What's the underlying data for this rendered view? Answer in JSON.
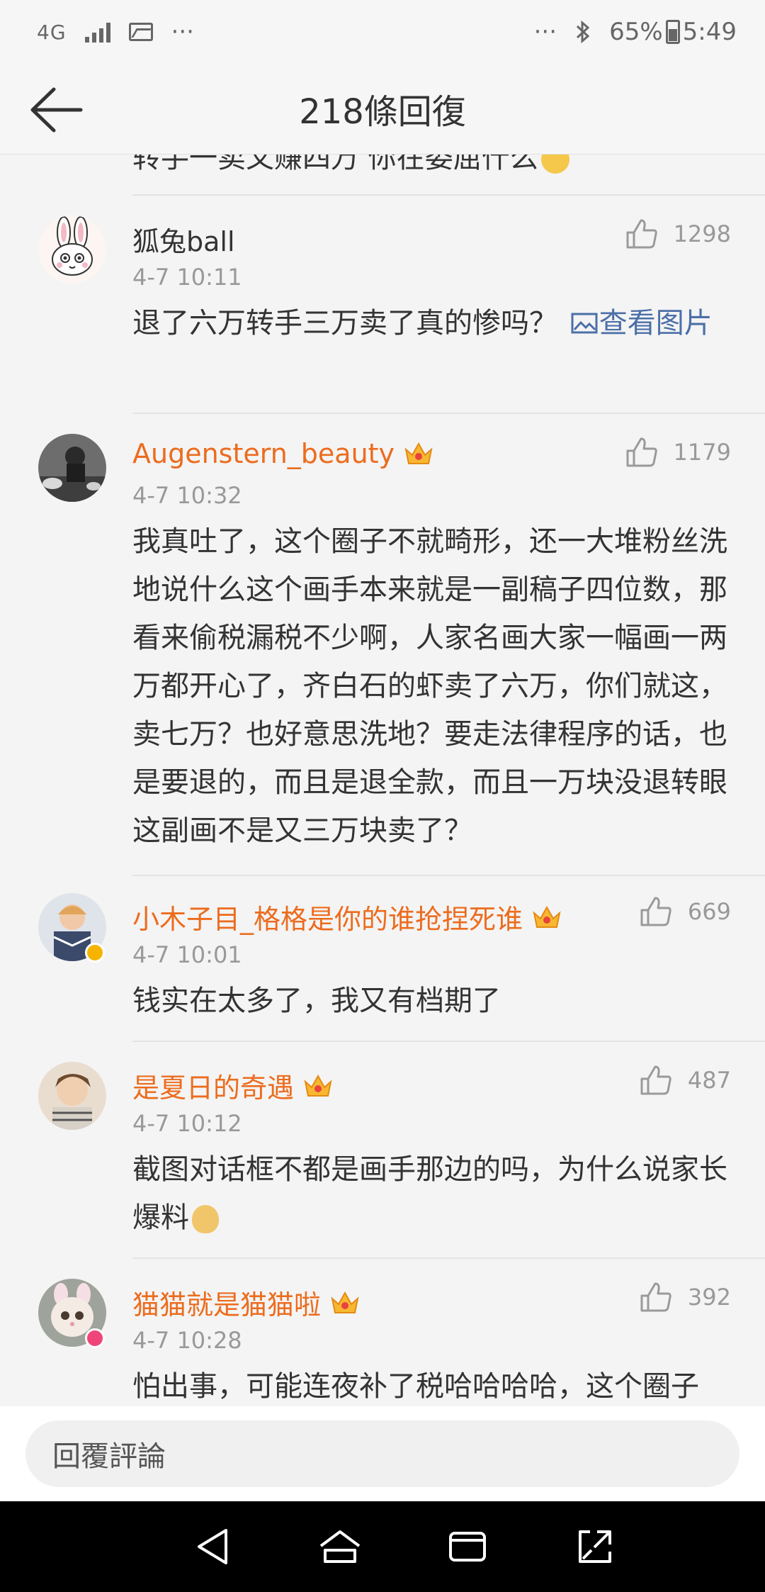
{
  "status_bar": {
    "network": "4G",
    "more_left": "···",
    "more_right": "···",
    "battery": "65%",
    "time": "5:49",
    "icons": [
      "signal-icon",
      "image-notification-icon",
      "bluetooth-icon",
      "battery-icon"
    ]
  },
  "header": {
    "title": "218條回復",
    "back_icon": "back-arrow-icon"
  },
  "partial_comment": {
    "text": "转手一卖又赚四万 你在委屈什么"
  },
  "comments": [
    {
      "username": "狐兔ball",
      "time": "4-7 10:11",
      "likes": "1298",
      "text": "退了六万转手三万卖了真的惨吗？",
      "link": "查看图片",
      "vip": false
    },
    {
      "username": "Augenstern_beauty",
      "time": "4-7 10:32",
      "likes": "1179",
      "text": "我真吐了，这个圈子不就畸形，还一大堆粉丝洗地说什么这个画手本来就是一副稿子四位数，那看来偷税漏税不少啊，人家名画大家一幅画一两万都开心了，齐白石的虾卖了六万，你们就这，卖七万？也好意思洗地？要走法律程序的话，也是要退的，而且是退全款，而且一万块没退转眼这副画不是又三万块卖了？",
      "vip": true
    },
    {
      "username": "小木子目_格格是你的谁抢捏死谁",
      "time": "4-7 10:01",
      "likes": "669",
      "text": "钱实在太多了，我又有档期了",
      "vip": true
    },
    {
      "username": "是夏日的奇遇",
      "time": "4-7 10:12",
      "likes": "487",
      "text": "截图对话框不都是画手那边的吗，为什么说家长爆料",
      "vip": true
    },
    {
      "username": "猫猫就是猫猫啦",
      "time": "4-7 10:28",
      "likes": "392",
      "text": "怕出事，可能连夜补了税哈哈哈哈，这个圈子",
      "vip": true
    }
  ],
  "reply_bar": {
    "placeholder": "回覆評論"
  },
  "navbar": {
    "buttons": [
      "nav-back-icon",
      "nav-home-icon",
      "nav-recents-icon",
      "nav-expand-icon"
    ]
  },
  "colors": {
    "accent_orange": "#ec6c1e",
    "link_blue": "#4c6fa8",
    "muted_gray": "#999999"
  }
}
